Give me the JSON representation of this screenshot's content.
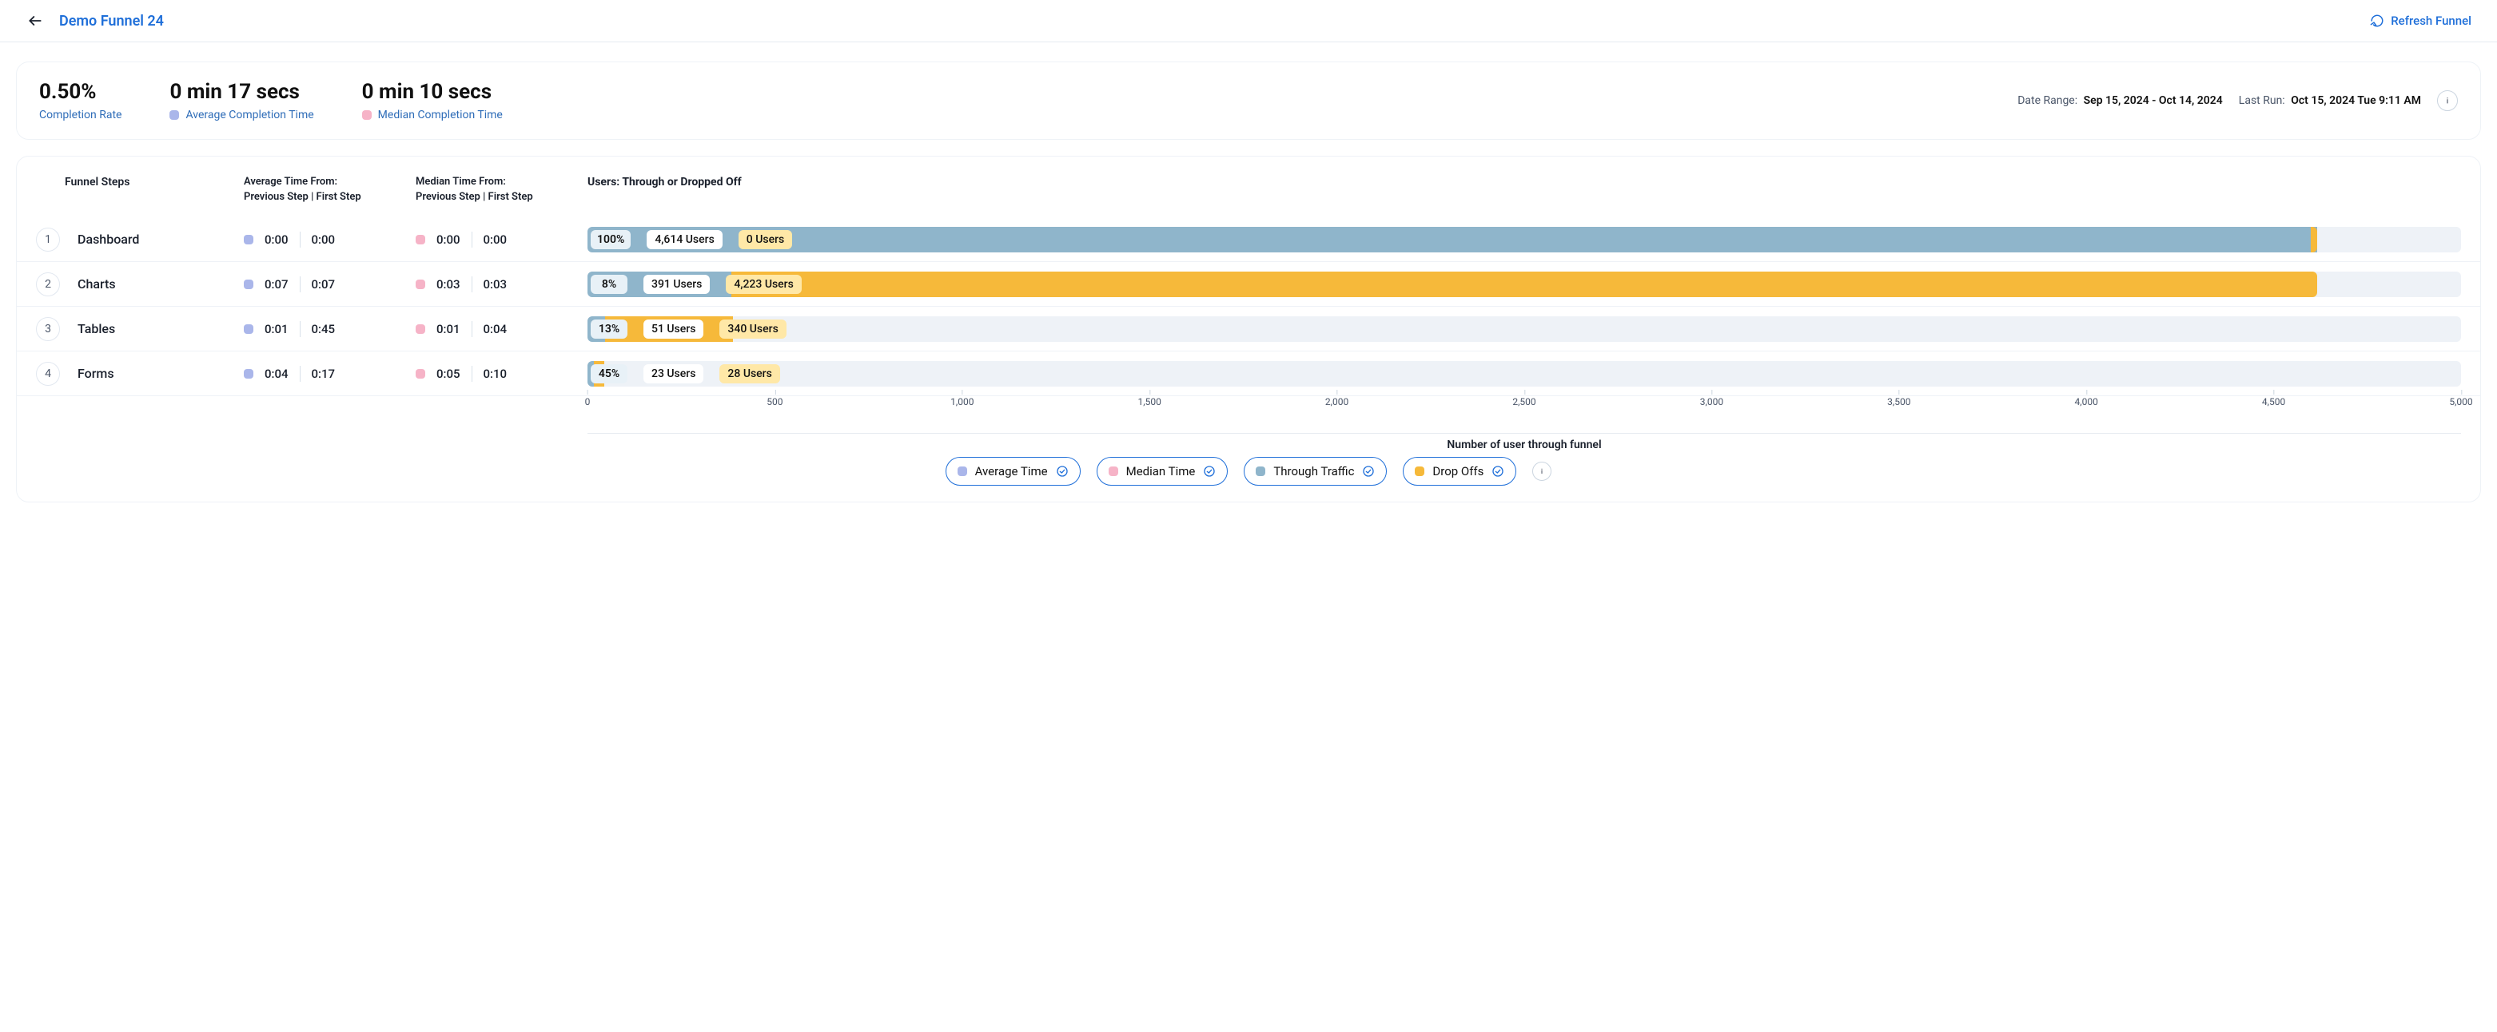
{
  "header": {
    "title": "Demo Funnel 24",
    "refresh_label": "Refresh Funnel"
  },
  "summary": {
    "completion_rate_value": "0.50%",
    "completion_rate_label": "Completion Rate",
    "avg_time_value": "0 min 17 secs",
    "avg_time_label": "Average Completion Time",
    "med_time_value": "0 min 10 secs",
    "med_time_label": "Median Completion Time",
    "date_range_key": "Date Range:",
    "date_range_value": "Sep 15, 2024 - Oct 14, 2024",
    "last_run_key": "Last Run:",
    "last_run_value": "Oct 15, 2024 Tue 9:11 AM"
  },
  "columns": {
    "steps": "Funnel Steps",
    "avg_line1": "Average Time From:",
    "avg_line2": "Previous Step | First Step",
    "med_line1": "Median Time From:",
    "med_line2": "Previous Step | First Step",
    "users": "Users: Through or Dropped Off"
  },
  "steps": {
    "0": {
      "num": "1",
      "name": "Dashboard",
      "avg_prev": "0:00",
      "avg_first": "0:00",
      "med_prev": "0:00",
      "med_first": "0:00",
      "pct": "100%",
      "through": "4,614 Users",
      "drop": "0 Users"
    },
    "1": {
      "num": "2",
      "name": "Charts",
      "avg_prev": "0:07",
      "avg_first": "0:07",
      "med_prev": "0:03",
      "med_first": "0:03",
      "pct": "8%",
      "through": "391 Users",
      "drop": "4,223 Users"
    },
    "2": {
      "num": "3",
      "name": "Tables",
      "avg_prev": "0:01",
      "avg_first": "0:45",
      "med_prev": "0:01",
      "med_first": "0:04",
      "pct": "13%",
      "through": "51 Users",
      "drop": "340 Users"
    },
    "3": {
      "num": "4",
      "name": "Forms",
      "avg_prev": "0:04",
      "avg_first": "0:17",
      "med_prev": "0:05",
      "med_first": "0:10",
      "pct": "45%",
      "through": "23 Users",
      "drop": "28 Users"
    }
  },
  "axis": {
    "ticks": {
      "0": "0",
      "1": "500",
      "2": "1,000",
      "3": "1,500",
      "4": "2,000",
      "5": "2,500",
      "6": "3,000",
      "7": "3,500",
      "8": "4,000",
      "9": "4,500",
      "10": "5,000"
    },
    "label": "Number of user through funnel"
  },
  "legend": {
    "avg": "Average Time",
    "med": "Median Time",
    "thr": "Through Traffic",
    "drp": "Drop Offs"
  },
  "chart_data": {
    "type": "bar",
    "orientation": "horizontal",
    "stacked": true,
    "xlim": [
      0,
      5000
    ],
    "xlabel": "Number of user through funnel",
    "x_ticks": [
      0,
      500,
      1000,
      1500,
      2000,
      2500,
      3000,
      3500,
      4000,
      4500,
      5000
    ],
    "categories": [
      "Dashboard",
      "Charts",
      "Tables",
      "Forms"
    ],
    "series": [
      {
        "name": "Through Traffic",
        "values": [
          4614,
          391,
          51,
          23
        ],
        "percent_of_prev": [
          100,
          8,
          13,
          45
        ]
      },
      {
        "name": "Drop Offs",
        "values": [
          0,
          4223,
          340,
          28
        ]
      }
    ],
    "step_timing": [
      {
        "avg_from_prev_sec": 0,
        "avg_from_first_sec": 0,
        "med_from_prev_sec": 0,
        "med_from_first_sec": 0
      },
      {
        "avg_from_prev_sec": 7,
        "avg_from_first_sec": 7,
        "med_from_prev_sec": 3,
        "med_from_first_sec": 3
      },
      {
        "avg_from_prev_sec": 1,
        "avg_from_first_sec": 45,
        "med_from_prev_sec": 1,
        "med_from_first_sec": 4
      },
      {
        "avg_from_prev_sec": 4,
        "avg_from_first_sec": 17,
        "med_from_prev_sec": 5,
        "med_from_first_sec": 10
      }
    ],
    "summary": {
      "completion_rate": 0.005,
      "avg_completion_sec": 17,
      "median_completion_sec": 10
    }
  }
}
